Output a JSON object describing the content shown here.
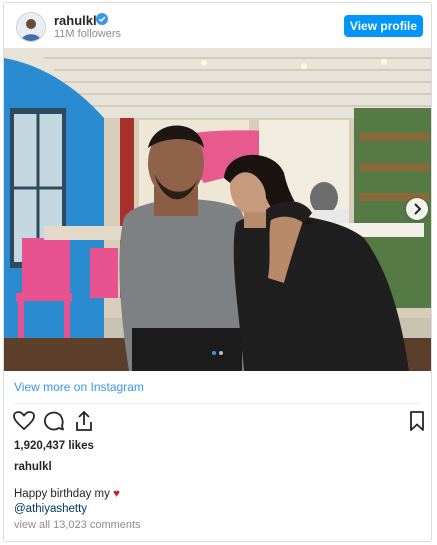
{
  "header": {
    "username": "rahulkl",
    "followers": "11M followers",
    "view_profile_label": "View profile"
  },
  "media": {
    "carousel_index": 1,
    "carousel_total": 2
  },
  "links": {
    "view_more": "View more on Instagram"
  },
  "stats": {
    "likes": "1,920,437 likes"
  },
  "post": {
    "owner": "rahulkl",
    "caption": "Happy birthday my",
    "mention": "@athiyashetty",
    "view_comments": "view all 13,023 comments"
  },
  "icons": {
    "verified": "verified-badge-icon",
    "like": "heart-icon",
    "comment": "comment-icon",
    "share": "share-icon",
    "save": "bookmark-icon",
    "caption_emoji": "red-heart-emoji-icon",
    "next": "chevron-right-icon"
  },
  "colors": {
    "accent": "#0095f6",
    "link": "#3897f0",
    "mention": "#00376b",
    "heart": "#c5202b",
    "muted": "#8e8e8e"
  }
}
